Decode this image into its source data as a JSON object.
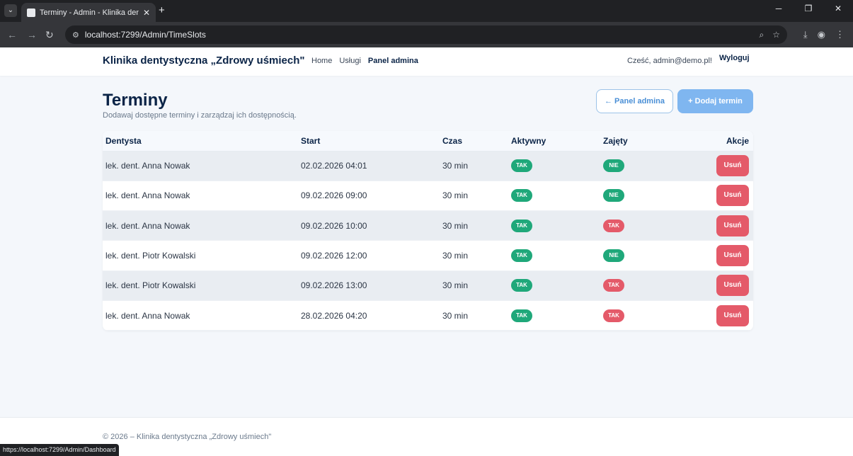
{
  "browser": {
    "tab_title": "Terminy - Admin - Klinika dentysty",
    "url": "localhost:7299/Admin/TimeSlots",
    "status_url": "https://localhost:7299/Admin/Dashboard"
  },
  "navbar": {
    "brand": "Klinika dentystyczna „Zdrowy uśmiech\"",
    "links": [
      "Home",
      "Usługi",
      "Panel admina"
    ],
    "greeting": "Cześć, admin@demo.pl!",
    "logout": "Wyloguj"
  },
  "header": {
    "title": "Terminy",
    "subtitle": "Dodawaj dostępne terminy i zarządzaj ich dostępnością.",
    "back_button": "← Panel admina",
    "add_button": "+ Dodaj termin"
  },
  "table": {
    "columns": [
      "Dentysta",
      "Start",
      "Czas",
      "Aktywny",
      "Zajęty",
      "Akcje"
    ],
    "rows": [
      {
        "dentist": "lek. dent. Anna Nowak",
        "start": "02.02.2026 04:01",
        "duration": "30 min",
        "active": "TAK",
        "busy": "NIE",
        "action": "Usuń"
      },
      {
        "dentist": "lek. dent. Anna Nowak",
        "start": "09.02.2026 09:00",
        "duration": "30 min",
        "active": "TAK",
        "busy": "NIE",
        "action": "Usuń"
      },
      {
        "dentist": "lek. dent. Anna Nowak",
        "start": "09.02.2026 10:00",
        "duration": "30 min",
        "active": "TAK",
        "busy": "TAK",
        "action": "Usuń"
      },
      {
        "dentist": "lek. dent. Piotr Kowalski",
        "start": "09.02.2026 12:00",
        "duration": "30 min",
        "active": "TAK",
        "busy": "NIE",
        "action": "Usuń"
      },
      {
        "dentist": "lek. dent. Piotr Kowalski",
        "start": "09.02.2026 13:00",
        "duration": "30 min",
        "active": "TAK",
        "busy": "TAK",
        "action": "Usuń"
      },
      {
        "dentist": "lek. dent. Anna Nowak",
        "start": "28.02.2026 04:20",
        "duration": "30 min",
        "active": "TAK",
        "busy": "TAK",
        "action": "Usuń"
      }
    ]
  },
  "footer": {
    "text": "© 2026 – Klinika dentystyczna „Zdrowy uśmiech\""
  },
  "colors": {
    "brand": "#0b2447",
    "green": "#1fa87a",
    "red": "#e45a69",
    "primary": "#7fb6f0"
  }
}
